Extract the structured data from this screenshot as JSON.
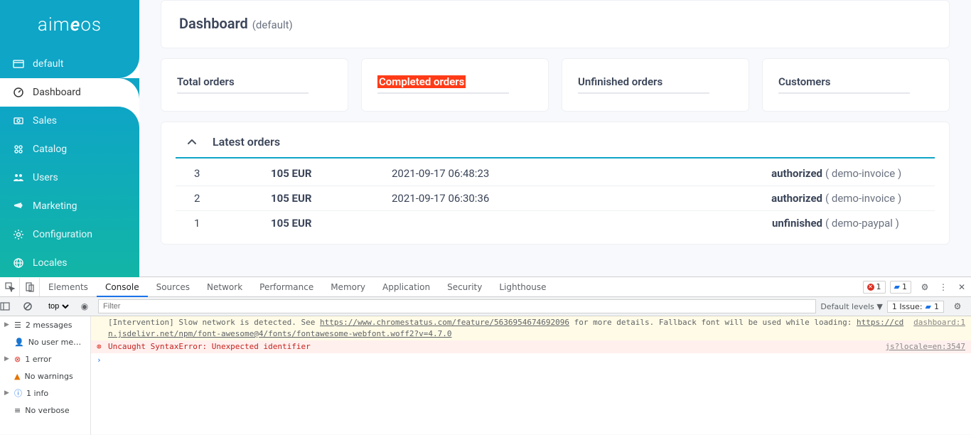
{
  "brand": {
    "text": "aimeos"
  },
  "sidebar": {
    "default_label": "default",
    "items": [
      {
        "label": "Dashboard",
        "icon": "dashboard"
      },
      {
        "label": "Sales",
        "icon": "sales"
      },
      {
        "label": "Catalog",
        "icon": "catalog"
      },
      {
        "label": "Users",
        "icon": "users"
      },
      {
        "label": "Marketing",
        "icon": "marketing"
      },
      {
        "label": "Configuration",
        "icon": "config"
      },
      {
        "label": "Locales",
        "icon": "locales"
      }
    ]
  },
  "header": {
    "title": "Dashboard",
    "context": "(default)"
  },
  "cards": [
    {
      "title": "Total orders",
      "highlight": false
    },
    {
      "title": "Completed orders",
      "highlight": true
    },
    {
      "title": "Unfinished orders",
      "highlight": false
    },
    {
      "title": "Customers",
      "highlight": false
    }
  ],
  "latest": {
    "title": "Latest orders",
    "rows": [
      {
        "id": "3",
        "amount": "105 EUR",
        "date": "2021-09-17 06:48:23",
        "status": "authorized",
        "method": "( demo-invoice )"
      },
      {
        "id": "2",
        "amount": "105 EUR",
        "date": "2021-09-17 06:30:36",
        "status": "authorized",
        "method": "( demo-invoice )"
      },
      {
        "id": "1",
        "amount": "105 EUR",
        "date": "",
        "status": "unfinished",
        "method": "( demo-paypal )"
      }
    ]
  },
  "devtools": {
    "tabs": [
      "Elements",
      "Console",
      "Sources",
      "Network",
      "Performance",
      "Memory",
      "Application",
      "Security",
      "Lighthouse"
    ],
    "active_tab": "Console",
    "top_err": "1",
    "top_msg": "1",
    "toolbar": {
      "ctx": "top",
      "filter_placeholder": "Filter",
      "levels": "Default levels",
      "issue_label": "1 Issue:",
      "issue_count": "1"
    },
    "sidebar": {
      "messages": "2 messages",
      "nouser": "No user me…",
      "error": "1 error",
      "warn": "No warnings",
      "info": "1 info",
      "verbose": "No verbose"
    },
    "lines": {
      "warn_a": "[Intervention] Slow network is detected. See ",
      "warn_link1": "https://www.chromestatus.com/feature/5636954674692096",
      "warn_b": " for more details. Fallback font will be used while loading: ",
      "warn_link2": "https://cdn.jsdelivr.net/npm/font-awesome@4/fonts/fontawesome-webfont.woff2?v=4.7.0",
      "warn_src": "dashboard:1",
      "err_msg": "Uncaught SyntaxError: Unexpected identifier",
      "err_src": "js?locale=en:3547"
    }
  }
}
